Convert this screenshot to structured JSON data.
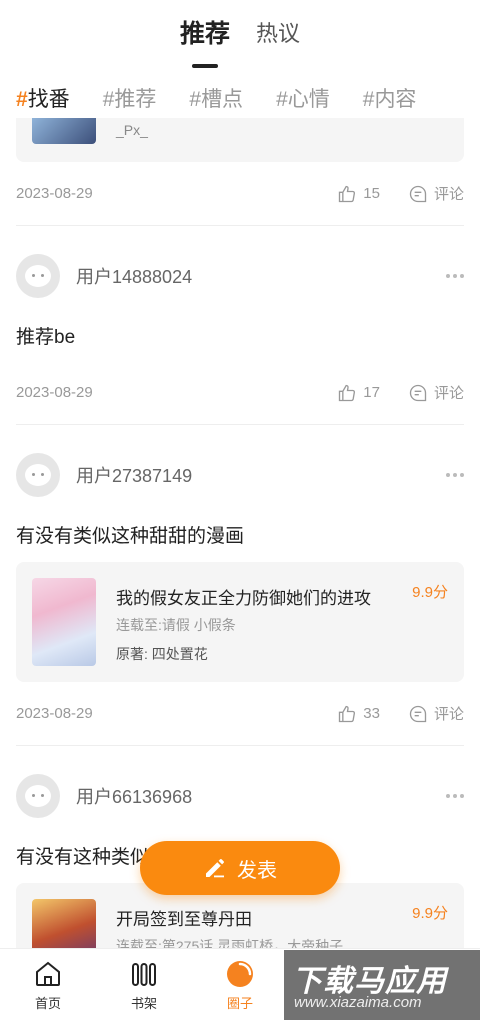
{
  "top_tabs": [
    {
      "label": "推荐",
      "active": true
    },
    {
      "label": "热议",
      "active": false
    }
  ],
  "tags": [
    {
      "hash": "#",
      "label": "找番",
      "active": true
    },
    {
      "hash": "#",
      "label": "推荐",
      "active": false
    },
    {
      "hash": "#",
      "label": "槽点",
      "active": false
    },
    {
      "hash": "#",
      "label": "心情",
      "active": false
    },
    {
      "hash": "#",
      "label": "内容",
      "active": false
    }
  ],
  "partial_post": {
    "card_text": "_Px_",
    "date": "2023-08-29",
    "likes": "15",
    "comment_label": "评论"
  },
  "posts": [
    {
      "username": "用户14888024",
      "text": "推荐be",
      "date": "2023-08-29",
      "likes": "17",
      "comment_label": "评论"
    },
    {
      "username": "用户27387149",
      "text": "有没有类似这种甜甜的漫画",
      "comic": {
        "title": "我的假女友正全力防御她们的进攻",
        "score": "9.9分",
        "line1": "连载至:请假 小假条",
        "line2": "原著: 四处置花"
      },
      "date": "2023-08-29",
      "likes": "33",
      "comment_label": "评论"
    },
    {
      "username": "用户66136968",
      "text": "有没有这种类似的漫画？",
      "comic": {
        "title": "开局签到至尊丹田",
        "score": "9.9分",
        "line1": "连载至:第275话 灵雨虹桥，大帝种子",
        "line2": ""
      }
    }
  ],
  "fab": {
    "label": "发表"
  },
  "bottom_nav": [
    {
      "label": "首页",
      "icon": "home-icon",
      "active": false
    },
    {
      "label": "书架",
      "icon": "bookshelf-icon",
      "active": false
    },
    {
      "label": "圈子",
      "icon": "circle-icon",
      "active": true
    },
    {
      "label": "",
      "icon": "",
      "active": false
    },
    {
      "label": "",
      "icon": "",
      "active": false
    }
  ],
  "watermark": {
    "line1": "下载马应用",
    "line2": "www.xiazaima.com"
  },
  "colors": {
    "accent": "#f5821f",
    "fab": "#fa8a0f"
  }
}
